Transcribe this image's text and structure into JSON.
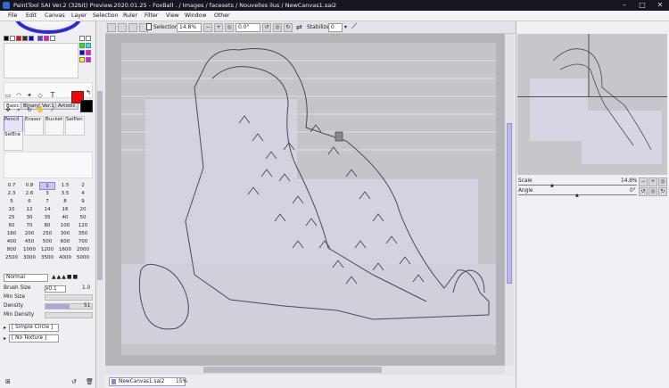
{
  "title": "PaintTool SAI Ver.2 (32bit) Preview.2020.01.25 - FoxBall . / Images / facesets / Nouvelles ilus / NewCanvas1.sai2",
  "window_buttons": {
    "minimize": "–",
    "maximize": "□",
    "close": "✕"
  },
  "menu": [
    "File",
    "Edit",
    "Canvas",
    "Layer",
    "Selection",
    "Ruler",
    "Filter",
    "View",
    "Window",
    "Other"
  ],
  "toolbar": {
    "selection_label": "Selection",
    "zoom": "14.8%",
    "angle": "0.0°",
    "stabilizer_label": "Stabilizer",
    "stabilizer_value": "0"
  },
  "colors": {
    "primary": "#ff0000",
    "secondary": "#000000",
    "palette": [
      "#000000",
      "#ffffff",
      "#ff0000",
      "#00c000",
      "#0000ff",
      "#00ffff",
      "#ff00ff",
      "#ffff00",
      "#606060",
      "#a0a0a0"
    ],
    "accent": "#c7c7f2"
  },
  "tool_tabs": [
    "Basic",
    "Binary",
    "Ver.1",
    "Artistic"
  ],
  "brush_tools": [
    "Pencil",
    "Eraser",
    "Bucket",
    "SelPen",
    "SelEra"
  ],
  "sizes": [
    "0.7",
    "0.8",
    "1",
    "1.5",
    "2",
    "2.3",
    "2.6",
    "3",
    "3.5",
    "4",
    "5",
    "6",
    "7",
    "8",
    "9",
    "10",
    "12",
    "14",
    "16",
    "20",
    "25",
    "30",
    "35",
    "40",
    "50",
    "60",
    "70",
    "80",
    "100",
    "120",
    "160",
    "200",
    "250",
    "300",
    "350",
    "400",
    "450",
    "500",
    "600",
    "700",
    "800",
    "1000",
    "1200",
    "1600",
    "2000",
    "2500",
    "3000",
    "3500",
    "4000",
    "5000"
  ],
  "selected_size": "1",
  "brush": {
    "blend_mode": "Normal",
    "size_label": "Brush Size",
    "size_mult": "x0.1",
    "size_value": "1.0",
    "min_size_label": "Min Size",
    "density_label": "Density",
    "density_value": "51",
    "min_density_label": "Min Density",
    "shape": "[ Simple Circle ]",
    "texture": "[ No Texture ]"
  },
  "document_tab": {
    "name": "NewCanvas1.sai2",
    "zoom": "15%"
  },
  "navigator": {
    "scale_label": "Scale",
    "scale_value": "14.8%",
    "angle_label": "Angle",
    "angle_value": "0°"
  }
}
